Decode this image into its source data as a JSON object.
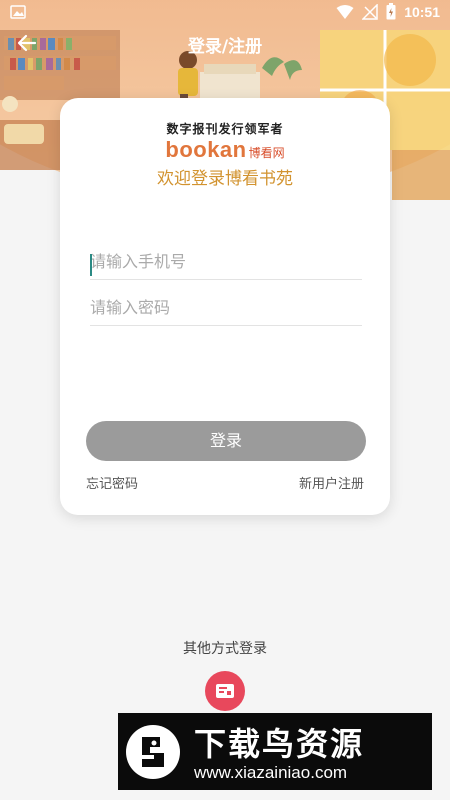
{
  "status_bar": {
    "time": "10:51",
    "icons": [
      "image-icon",
      "wifi-icon",
      "no-signal-icon",
      "battery-charging-icon"
    ]
  },
  "header": {
    "title": "登录/注册",
    "back_icon": "back-arrow-icon"
  },
  "brand": {
    "slogan": "数字报刊发行领军者",
    "logo_en": "bookan",
    "logo_cn": "博看网"
  },
  "welcome": "欢迎登录博看书苑",
  "form": {
    "phone_placeholder": "请输入手机号",
    "phone_value": "",
    "password_placeholder": "请输入密码",
    "password_value": "",
    "login_label": "登录",
    "forgot_label": "忘记密码",
    "register_label": "新用户注册"
  },
  "other_login": {
    "label": "其他方式登录",
    "icon": "card-icon"
  },
  "watermark": {
    "title": "下载鸟资源",
    "url": "www.xiazainiao.com"
  },
  "colors": {
    "accent": "#d2932f",
    "brand_orange": "#e1763c",
    "button_gray": "#9b9b9b",
    "other_login_red": "#e8485c"
  }
}
